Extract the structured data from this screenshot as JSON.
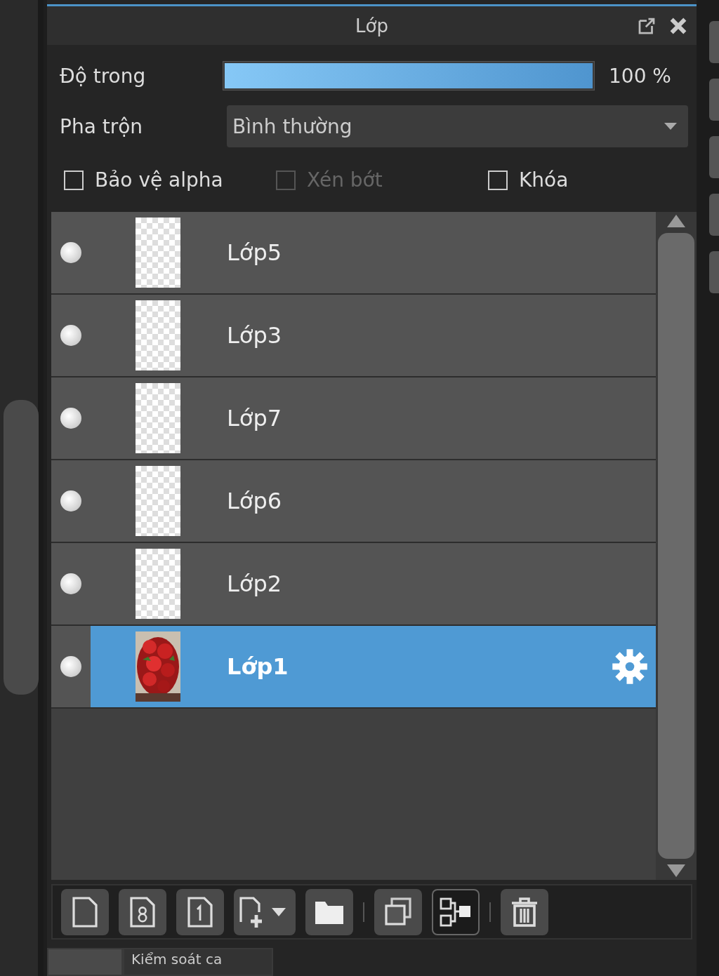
{
  "panel": {
    "title": "Lớp"
  },
  "opacity": {
    "label": "Độ trong",
    "level": 1,
    "reading": "100 %"
  },
  "blend": {
    "label": "Pha trộn",
    "value": "Bình thường"
  },
  "options": [
    {
      "label": "Bảo vệ alpha",
      "checked": false,
      "disabled": false
    },
    {
      "label": "Xén bớt",
      "checked": false,
      "disabled": true
    },
    {
      "label": "Khóa",
      "checked": false,
      "disabled": false
    }
  ],
  "layers": [
    {
      "name": "Lớp5",
      "visible": true,
      "kind": "empty",
      "selected": false
    },
    {
      "name": "Lớp3",
      "visible": true,
      "kind": "empty",
      "selected": false
    },
    {
      "name": "Lớp7",
      "visible": true,
      "kind": "empty",
      "selected": false
    },
    {
      "name": "Lớp6",
      "visible": true,
      "kind": "empty",
      "selected": false
    },
    {
      "name": "Lớp2",
      "visible": true,
      "kind": "empty",
      "selected": false
    },
    {
      "name": "Lớp1",
      "visible": true,
      "kind": "picture",
      "selected": true
    }
  ],
  "toolbar": [
    [
      {
        "kind": "page",
        "active": false
      },
      {
        "kind": "page8",
        "active": false
      },
      {
        "kind": "page1",
        "active": false
      },
      {
        "kind": "add",
        "active": false
      },
      {
        "kind": "folder",
        "active": false
      }
    ],
    [
      {
        "kind": "copy",
        "active": false
      },
      {
        "kind": "merge",
        "active": true
      }
    ],
    [
      {
        "kind": "trash",
        "active": false
      }
    ]
  ],
  "bottom_tabs": [
    {
      "selected": true
    },
    {
      "label": "Kiểm soát ca",
      "selected": false
    }
  ]
}
